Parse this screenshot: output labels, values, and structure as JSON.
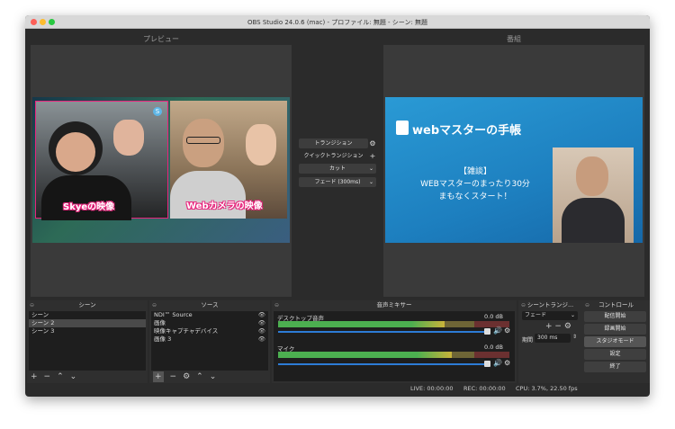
{
  "window": {
    "title": "OBS Studio 24.0.6 (mac) - プロファイル: 無題 - シーン: 無題"
  },
  "preview": {
    "header": "プレビュー",
    "skype_label": "Skyeの映像",
    "webcam_label": "Webカメラの映像"
  },
  "program": {
    "header": "番組",
    "logo_text": "webマスターの手帳",
    "caption_line1": "【雑談】",
    "caption_line2": "WEBマスターのまったり30分",
    "caption_line3": "まもなくスタート！"
  },
  "transition_center": {
    "transition_btn": "トランジション",
    "quick_btn": "クイックトランジション",
    "cut_btn": "カット",
    "fade_btn": "フェード (300ms)"
  },
  "scenes": {
    "header": "シーン",
    "items": [
      "シーン",
      "シーン 2",
      "シーン 3"
    ],
    "selected": 1
  },
  "sources": {
    "header": "ソース",
    "items": [
      "NDI™ Source",
      "画像",
      "映像キャプチャデバイス",
      "画像 3"
    ]
  },
  "mixer": {
    "header": "音声ミキサー",
    "tracks": [
      {
        "name": "デスクトップ音声",
        "level": "0.0 dB",
        "fill": 0.72
      },
      {
        "name": "マイク",
        "level": "0.0 dB",
        "fill": 0.75
      }
    ]
  },
  "scene_transitions": {
    "header": "シーントランジ...",
    "type": "フェード",
    "duration_label": "期間",
    "duration_value": "300 ms"
  },
  "controls": {
    "header": "コントロール",
    "buttons": [
      "配信開始",
      "録画開始",
      "スタジオモード",
      "設定",
      "終了"
    ]
  },
  "status_bar": {
    "live": "LIVE: 00:00:00",
    "rec": "REC: 00:00:00",
    "cpu": "CPU: 3.7%, 22.50 fps"
  },
  "colors": {
    "accent": "#e8237c",
    "program_bg": "#1a8fc9",
    "meter_green": "#4caf50",
    "meter_yellow": "#c9b33a",
    "meter_red": "#c0392b",
    "volume_blue": "#2d7cd6"
  },
  "icons": {
    "gear": "gear-icon",
    "plus": "plus-icon",
    "chevron": "chevron-down-icon",
    "eye": "eye-icon",
    "lock": "lock-icon",
    "speaker": "speaker-icon"
  }
}
